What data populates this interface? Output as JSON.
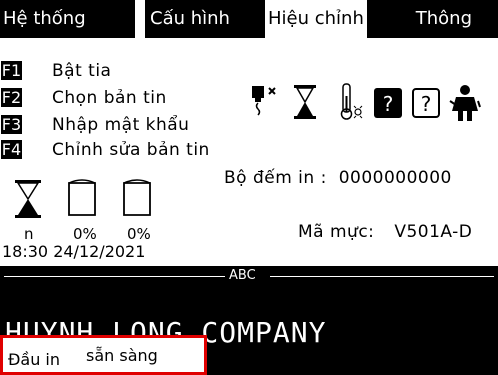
{
  "menu": {
    "items": [
      "Hệ thống",
      "Cấu hình",
      "Hiệu chỉnh",
      "Thông"
    ]
  },
  "functions": [
    {
      "key": "F1",
      "label": "Bật tia"
    },
    {
      "key": "F2",
      "label": "Chọn bản tin"
    },
    {
      "key": "F3",
      "label": "Nhập mật khẩu"
    },
    {
      "key": "F4",
      "label": "Chỉnh sửa bản tin"
    }
  ],
  "status_icons": [
    "print-head-error-icon",
    "hourglass-icon",
    "thermometer-icon",
    "help-filled-icon",
    "help-outline-icon",
    "technician-icon"
  ],
  "counter": {
    "label": "Bộ đếm in :",
    "value": "0000000000"
  },
  "levels": [
    {
      "icon": "hourglass-icon",
      "value": "n"
    },
    {
      "icon": "ink-tank-icon",
      "value": "0%"
    },
    {
      "icon": "solvent-tank-icon",
      "value": "0%"
    }
  ],
  "ink_code": {
    "label": "Mã mực:",
    "value": "V501A-D"
  },
  "datetime": "18:30 24/12/2021",
  "message_panel": {
    "title": "ABC",
    "text": "HUYNH LONG COMPANY"
  },
  "status": {
    "prefix": "Đầu in",
    "state": "sẵn sàng"
  },
  "colors": {
    "highlight": "#e00000",
    "panel": "#000000"
  }
}
